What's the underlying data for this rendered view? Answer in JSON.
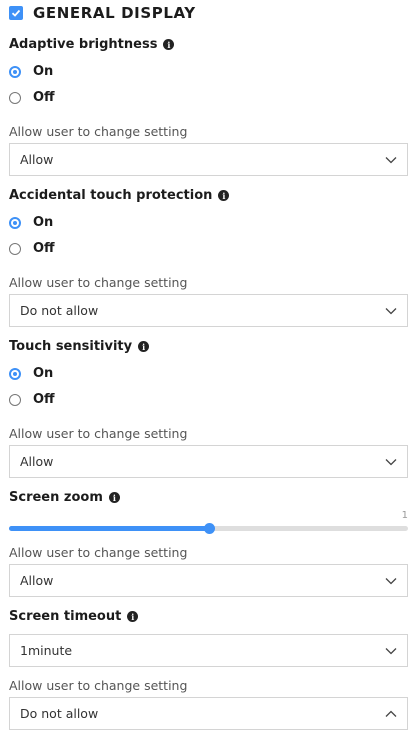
{
  "header": {
    "title": "GENERAL DISPLAY",
    "checked": true
  },
  "adaptive": {
    "label": "Adaptive brightness",
    "on": "On",
    "off": "Off",
    "selected": "On",
    "allow_label": "Allow user to change setting",
    "allow_value": "Allow"
  },
  "touch_protection": {
    "label": "Accidental touch protection",
    "on": "On",
    "off": "Off",
    "selected": "On",
    "allow_label": "Allow user to change setting",
    "allow_value": "Do not allow"
  },
  "touch_sensitivity": {
    "label": "Touch sensitivity",
    "on": "On",
    "off": "Off",
    "selected": "On",
    "allow_label": "Allow user to change setting",
    "allow_value": "Allow"
  },
  "screen_zoom": {
    "label": "Screen zoom",
    "value_text": "1",
    "level_fraction": 0.5,
    "allow_label": "Allow user to change setting",
    "allow_value": "Allow"
  },
  "screen_timeout": {
    "label": "Screen timeout",
    "value": "1minute",
    "allow_label": "Allow user to change setting",
    "allow_value": "Do not allow"
  },
  "colors": {
    "accent": "#3e91f7",
    "border": "#d4d4d4",
    "track": "#dedede"
  }
}
